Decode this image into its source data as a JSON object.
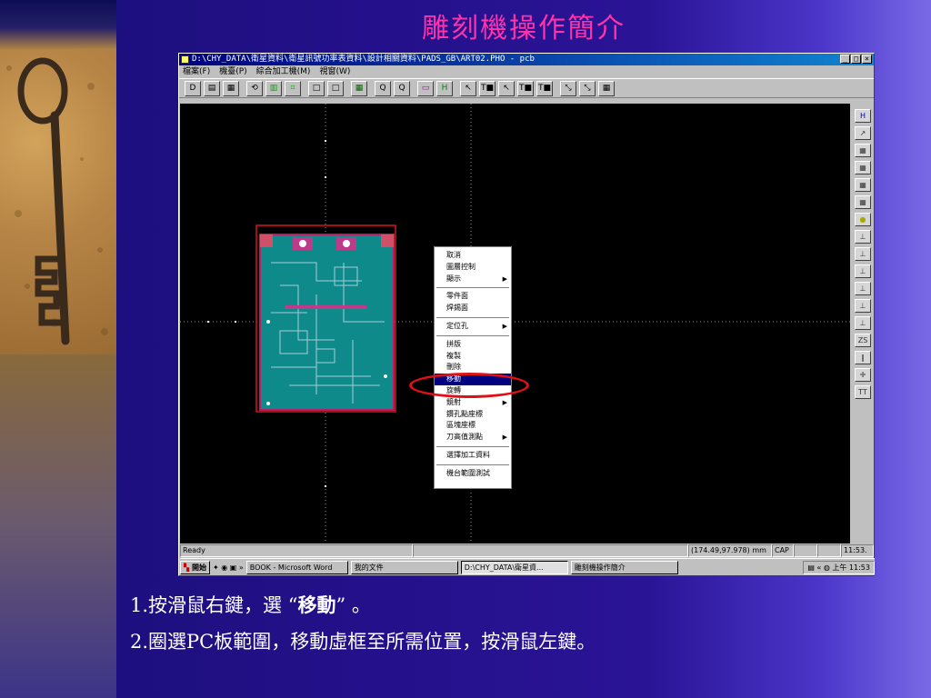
{
  "slide": {
    "title": "雕刻機操作簡介",
    "notes": [
      {
        "prefix": "1.按滑鼠右鍵，選 “",
        "bold": "移動",
        "suffix": "” 。"
      },
      {
        "text": "2.圈選PC板範圍，移動虛框至所需位置，按滑鼠左鍵。"
      }
    ]
  },
  "window": {
    "title": "D:\\CHY_DATA\\衛星資料\\衛星訊號功率表資料\\設計相關資料\\PADS_GB\\ART02.PHO - pcb",
    "controls": [
      "_",
      "□",
      "×"
    ],
    "menu": [
      "檔案(F)",
      "機臺(P)",
      "綜合加工機(M)",
      "視窗(W)"
    ]
  },
  "toolbar": [
    "D",
    "▤",
    "▦",
    "⟲",
    "▥",
    "⌗",
    "□",
    "□",
    "▦",
    "Q",
    "Q",
    "▭",
    "H",
    "↖",
    "T■",
    "↖",
    "T■",
    "T■",
    "⤡",
    "⤡",
    "▦"
  ],
  "right_toolbar": [
    "H",
    "↗",
    "▦",
    "▦",
    "▦",
    "▦",
    "●",
    "⊥",
    "⊥",
    "⊥",
    "⊥",
    "⊥",
    "⊥",
    "ZS",
    "∥",
    "✛",
    "TT"
  ],
  "context_menu": {
    "items": [
      {
        "label": "取消"
      },
      {
        "label": "圖層控制"
      },
      {
        "label": "顯示",
        "submenu": true
      },
      {
        "sep": true
      },
      {
        "label": "零件面"
      },
      {
        "label": "焊錫面"
      },
      {
        "sep": true
      },
      {
        "label": "定位孔",
        "submenu": true
      },
      {
        "sep": true
      },
      {
        "label": "拼版"
      },
      {
        "label": "複製"
      },
      {
        "label": "刪除"
      },
      {
        "label": "移動",
        "highlight": true
      },
      {
        "label": "旋轉"
      },
      {
        "label": "鏡射",
        "submenu": true
      },
      {
        "label": "鑽孔點座標"
      },
      {
        "label": "區塊座標"
      },
      {
        "label": "刀高值測點",
        "submenu": true
      },
      {
        "sep": true
      },
      {
        "label": "選擇加工資料"
      },
      {
        "sep": true
      },
      {
        "label": "機台範圍測試"
      }
    ]
  },
  "status": {
    "ready": "Ready",
    "coords": "(174.49,97.978) mm",
    "cap": "CAP",
    "time": "11:53."
  },
  "taskbar": {
    "start": "開始",
    "tasks": [
      "BOOK - Microsoft Word",
      "我的文件",
      "D:\\CHY_DATA\\衛星資...",
      "雕刻機操作簡介"
    ],
    "active_index": 2,
    "clock": "上午 11:53"
  },
  "colors": {
    "title": "#ff33aa",
    "pcb": "#0e8a8a",
    "pcb_border": "#e0101a",
    "highlight": "#000080",
    "ring": "#e0101a"
  }
}
